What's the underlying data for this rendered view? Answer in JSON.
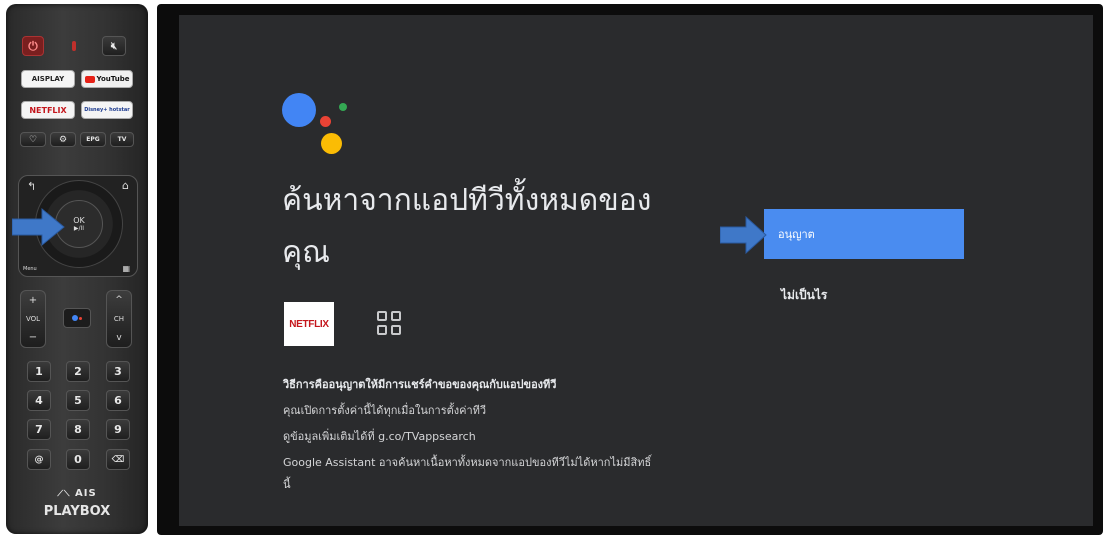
{
  "remote": {
    "power_icon": "power-icon",
    "mic_icon": "mic-icon",
    "mute_icon": "mute-icon",
    "apps": [
      "AISPLAY",
      "YouTube",
      "NETFLIX",
      "Disney+ hotstar"
    ],
    "small_buttons": [
      "♡",
      "⚙",
      "EPG",
      "TV"
    ],
    "ok_label": "OK",
    "play_pause": "▶/II",
    "menu_label": "Menu",
    "vol_label": "VOL",
    "ch_label": "CH",
    "plus": "+",
    "minus": "−",
    "ch_up": "^",
    "ch_down": "v",
    "numbers": [
      "1",
      "2",
      "3",
      "4",
      "5",
      "6",
      "7",
      "8",
      "9",
      "@",
      "0",
      "⌫"
    ],
    "brand_top": "AIS",
    "brand_bottom": "PLAYBOX"
  },
  "screen": {
    "title_line1": "ค้นหาจากแอปทีวีทั้งหมดของ",
    "title_line2": "คุณ",
    "netflix_tile": "NETFLIX",
    "desc_heading": "วิธีการคืออนุญาตให้มีการแชร์คำขอของคุณกับแอปของทีวี",
    "desc_line1": "คุณเปิดการตั้งค่านี้ได้ทุกเมื่อในการตั้งค่าทีวี",
    "desc_line2": "ดูข้อมูลเพิ่มเติมได้ที่ g.co/TVappsearch",
    "desc_line3": "Google Assistant อาจค้นหาเนื้อหาทั้งหมดจากแอปของทีวีไม่ได้หากไม่มีสิทธิ์",
    "desc_line4": "นี้",
    "allow_button": "อนุญาต",
    "deny_button": "ไม่เป็นไร"
  },
  "colors": {
    "google_blue": "#4285f4",
    "google_red": "#ea4335",
    "google_yellow": "#fbbc04",
    "google_green": "#34a853",
    "allow_button_bg": "#4a8cf0",
    "arrow": "#3f78c8"
  }
}
